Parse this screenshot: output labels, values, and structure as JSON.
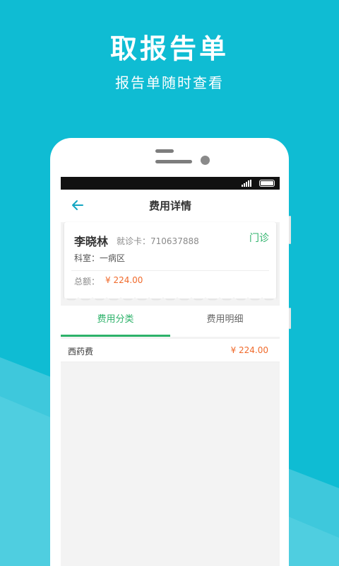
{
  "promo": {
    "title": "取报告单",
    "subtitle": "报告单随时查看"
  },
  "colors": {
    "background": "#0fbcd3",
    "accent_green": "#2db26a",
    "amount_orange": "#f06a2b",
    "back_arrow": "#13a6c2"
  },
  "app": {
    "nav": {
      "back_icon": "arrow-left-icon",
      "title": "费用详情"
    },
    "patient_card": {
      "name": "李晓林",
      "card_label": "就诊卡：",
      "card_number": "710637888",
      "visit_type": "门诊",
      "dept_label": "科室：",
      "dept": "一病区",
      "total_label": "总额：",
      "total_value": "¥ 224.00"
    },
    "tabs": [
      {
        "label": "费用分类",
        "active": true
      },
      {
        "label": "费用明细",
        "active": false
      }
    ],
    "fee_rows": [
      {
        "name": "西药费",
        "amount": "¥ 224.00"
      }
    ]
  }
}
